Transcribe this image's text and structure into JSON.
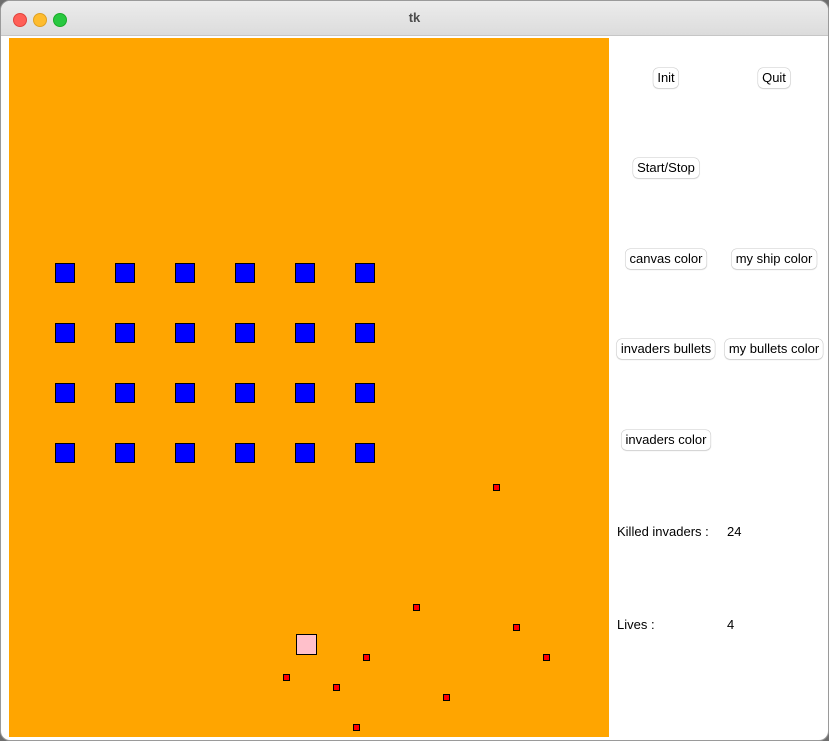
{
  "window": {
    "title": "tk"
  },
  "canvas": {
    "color": "#ffa500",
    "invader_color": "#0000ff",
    "ship_color": "#ffc0cb",
    "bullet_color": "#ff0000"
  },
  "invaders": {
    "rows": 4,
    "columns": 6
  },
  "enemy_bullet_count": 9,
  "controls": {
    "init": "Init",
    "quit": "Quit",
    "start_stop": "Start/Stop",
    "canvas_color": "canvas color",
    "ship_color": "my ship color",
    "invaders_bullets": "invaders bullets",
    "bullets_color": "my bullets color",
    "invaders_color": "invaders color"
  },
  "stats": {
    "killed_label": "Killed invaders :",
    "killed_value": "24",
    "lives_label": "Lives :",
    "lives_value": "4"
  }
}
